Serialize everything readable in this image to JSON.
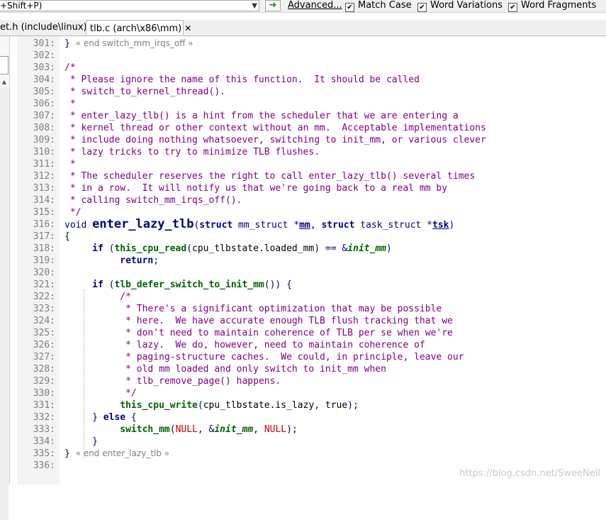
{
  "toolbar": {
    "search_text": "+Shift+P)",
    "dropdown_icon": "chevron-down-icon",
    "go_icon": "arrow-right-icon",
    "advanced_label": "Advanced...",
    "match_case_label": "Match Case",
    "word_variations_label": "Word Variations",
    "word_fragments_label": "Word Fragments",
    "match_case_checked": true,
    "word_variations_checked": true,
    "word_fragments_checked": true,
    "check_mark": "✔"
  },
  "tabs": [
    {
      "label": "et.h (include\\linux)"
    },
    {
      "label": "tlb.c (arch\\x86\\mm)",
      "close": "✕"
    }
  ],
  "lines": [
    {
      "num": "301:",
      "parts": [
        {
          "c": "o",
          "t": "} "
        },
        {
          "c": "fold",
          "t": "« end switch_mm_irqs_off »"
        }
      ]
    },
    {
      "num": "302:",
      "parts": []
    },
    {
      "num": "303:",
      "parts": [
        {
          "c": "c",
          "t": "/*"
        }
      ]
    },
    {
      "num": "304:",
      "parts": [
        {
          "c": "c",
          "t": " * Please ignore the name of this function.  It should be called"
        }
      ]
    },
    {
      "num": "305:",
      "parts": [
        {
          "c": "c",
          "t": " * switch_to_kernel_thread()."
        }
      ]
    },
    {
      "num": "306:",
      "parts": [
        {
          "c": "c",
          "t": " *"
        }
      ]
    },
    {
      "num": "307:",
      "parts": [
        {
          "c": "c",
          "t": " * enter_lazy_tlb() is a hint from the scheduler that we are entering a"
        }
      ]
    },
    {
      "num": "308:",
      "parts": [
        {
          "c": "c",
          "t": " * kernel thread or other context without an mm.  Acceptable implementations"
        }
      ]
    },
    {
      "num": "309:",
      "parts": [
        {
          "c": "c",
          "t": " * include doing nothing whatsoever, switching to init_mm, or various clever"
        }
      ]
    },
    {
      "num": "310:",
      "parts": [
        {
          "c": "c",
          "t": " * lazy tricks to try to minimize TLB flushes."
        }
      ]
    },
    {
      "num": "311:",
      "parts": [
        {
          "c": "c",
          "t": " *"
        }
      ]
    },
    {
      "num": "312:",
      "parts": [
        {
          "c": "c",
          "t": " * The scheduler reserves the right to call enter_lazy_tlb() several times"
        }
      ]
    },
    {
      "num": "313:",
      "parts": [
        {
          "c": "c",
          "t": " * in a row.  It will notify us that we're going back to a real mm by"
        }
      ]
    },
    {
      "num": "314:",
      "parts": [
        {
          "c": "c",
          "t": " * calling switch_mm_irqs_off()."
        }
      ]
    },
    {
      "num": "315:",
      "parts": [
        {
          "c": "c",
          "t": " */"
        }
      ]
    },
    {
      "num": "316:",
      "parts": [
        {
          "c": "t",
          "t": "void "
        },
        {
          "c": "fd",
          "t": "enter_lazy_tlb"
        },
        {
          "c": "o",
          "t": "("
        },
        {
          "c": "k",
          "t": "struct"
        },
        {
          "c": "t",
          "t": " mm_struct *"
        },
        {
          "c": "p",
          "t": "mm"
        },
        {
          "c": "o",
          "t": ", "
        },
        {
          "c": "k",
          "t": "struct"
        },
        {
          "c": "t",
          "t": " task_struct *"
        },
        {
          "c": "p",
          "t": "tsk"
        },
        {
          "c": "o",
          "t": ")"
        }
      ]
    },
    {
      "num": "317:",
      "parts": [
        {
          "c": "o",
          "t": "{"
        }
      ]
    },
    {
      "num": "318:",
      "parts": [
        {
          "c": "s",
          "t": "     "
        },
        {
          "c": "k",
          "t": "if"
        },
        {
          "c": "o",
          "t": " ("
        },
        {
          "c": "f",
          "t": "this_cpu_read"
        },
        {
          "c": "o",
          "t": "("
        },
        {
          "c": "s",
          "t": "cpu_tlbstate.loaded_mm"
        },
        {
          "c": "o",
          "t": ") == &"
        },
        {
          "c": "g",
          "t": "init_mm"
        },
        {
          "c": "o",
          "t": ")"
        }
      ]
    },
    {
      "num": "319:",
      "parts": [
        {
          "c": "s",
          "t": "          "
        },
        {
          "c": "k",
          "t": "return"
        },
        {
          "c": "o",
          "t": ";"
        }
      ]
    },
    {
      "num": "320:",
      "parts": []
    },
    {
      "num": "321:",
      "parts": [
        {
          "c": "s",
          "t": "     "
        },
        {
          "c": "k",
          "t": "if"
        },
        {
          "c": "o",
          "t": " ("
        },
        {
          "c": "f",
          "t": "tlb_defer_switch_to_init_mm"
        },
        {
          "c": "o",
          "t": "()) {"
        }
      ]
    },
    {
      "num": "322:",
      "parts": [
        {
          "c": "s",
          "t": "          "
        },
        {
          "c": "c",
          "t": "/*"
        }
      ]
    },
    {
      "num": "323:",
      "parts": [
        {
          "c": "s",
          "t": "          "
        },
        {
          "c": "c",
          "t": " * There's a significant optimization that may be possible"
        }
      ]
    },
    {
      "num": "324:",
      "parts": [
        {
          "c": "s",
          "t": "          "
        },
        {
          "c": "c",
          "t": " * here.  We have accurate enough TLB flush tracking that we"
        }
      ]
    },
    {
      "num": "325:",
      "parts": [
        {
          "c": "s",
          "t": "          "
        },
        {
          "c": "c",
          "t": " * don't need to maintain coherence of TLB per se when we're"
        }
      ]
    },
    {
      "num": "326:",
      "parts": [
        {
          "c": "s",
          "t": "          "
        },
        {
          "c": "c",
          "t": " * lazy.  We do, however, need to maintain coherence of"
        }
      ]
    },
    {
      "num": "327:",
      "parts": [
        {
          "c": "s",
          "t": "          "
        },
        {
          "c": "c",
          "t": " * paging-structure caches.  We could, in principle, leave our"
        }
      ]
    },
    {
      "num": "328:",
      "parts": [
        {
          "c": "s",
          "t": "          "
        },
        {
          "c": "c",
          "t": " * old mm loaded and only switch to init_mm when"
        }
      ]
    },
    {
      "num": "329:",
      "parts": [
        {
          "c": "s",
          "t": "          "
        },
        {
          "c": "c",
          "t": " * tlb_remove_page() happens."
        }
      ]
    },
    {
      "num": "330:",
      "parts": [
        {
          "c": "s",
          "t": "          "
        },
        {
          "c": "c",
          "t": " */"
        }
      ]
    },
    {
      "num": "331:",
      "parts": [
        {
          "c": "s",
          "t": "          "
        },
        {
          "c": "f",
          "t": "this_cpu_write"
        },
        {
          "c": "o",
          "t": "("
        },
        {
          "c": "s",
          "t": "cpu_tlbstate.is_lazy"
        },
        {
          "c": "o",
          "t": ", "
        },
        {
          "c": "s",
          "t": "true"
        },
        {
          "c": "o",
          "t": ");"
        }
      ]
    },
    {
      "num": "332:",
      "parts": [
        {
          "c": "s",
          "t": "     "
        },
        {
          "c": "o",
          "t": "} "
        },
        {
          "c": "k",
          "t": "else"
        },
        {
          "c": "o",
          "t": " {"
        }
      ]
    },
    {
      "num": "333:",
      "parts": [
        {
          "c": "s",
          "t": "          "
        },
        {
          "c": "f",
          "t": "switch_mm"
        },
        {
          "c": "o",
          "t": "("
        },
        {
          "c": "n",
          "t": "NULL"
        },
        {
          "c": "o",
          "t": ", &"
        },
        {
          "c": "g",
          "t": "init_mm"
        },
        {
          "c": "o",
          "t": ", "
        },
        {
          "c": "n",
          "t": "NULL"
        },
        {
          "c": "o",
          "t": ");"
        }
      ]
    },
    {
      "num": "334:",
      "parts": [
        {
          "c": "s",
          "t": "     "
        },
        {
          "c": "o",
          "t": "}"
        }
      ]
    },
    {
      "num": "335:",
      "parts": [
        {
          "c": "o",
          "t": "} "
        },
        {
          "c": "fold",
          "t": "« end enter_lazy_tlb »"
        }
      ]
    },
    {
      "num": "336:",
      "parts": []
    }
  ],
  "watermark": "https://blog.csdn.net/SweeNeil"
}
